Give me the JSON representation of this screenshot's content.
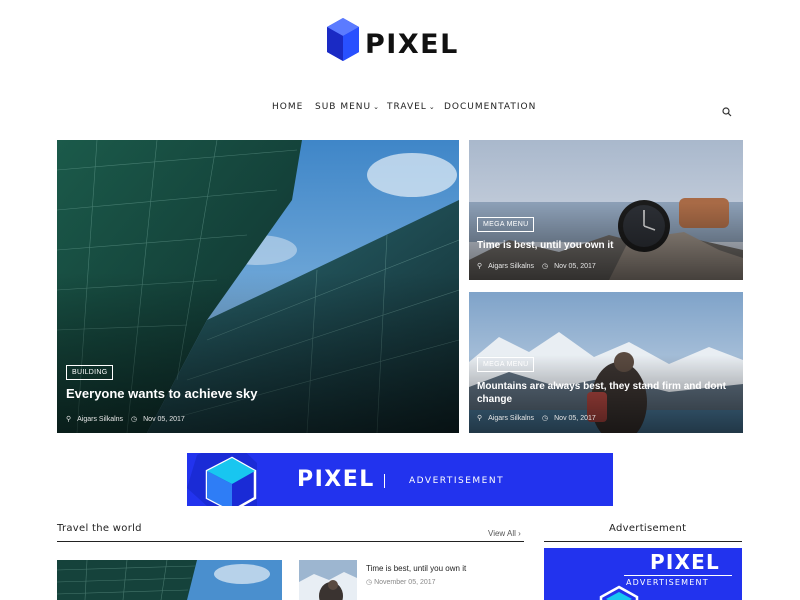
{
  "brand": {
    "name": "PIXEL",
    "accent": "#2233ee",
    "logo_icon": "hexagon-logo-icon"
  },
  "nav": {
    "items": [
      {
        "label": "HOME",
        "dropdown": false
      },
      {
        "label": "SUB MENU",
        "dropdown": true
      },
      {
        "label": "TRAVEL",
        "dropdown": true
      },
      {
        "label": "DOCUMENTATION",
        "dropdown": false
      }
    ],
    "chevron": "⌄",
    "search_icon": "search-icon"
  },
  "features": {
    "main": {
      "category": "BUILDING",
      "title": "Everyone wants to achieve sky",
      "author": "Aigars Silkalns",
      "date": "Nov 05, 2017"
    },
    "top_right": {
      "category": "MEGA MENU",
      "title": "Time is best, until you own it",
      "author": "Aigars Silkalns",
      "date": "Nov 05, 2017"
    },
    "bottom_right": {
      "category": "MEGA MENU",
      "title": "Mountains are always best, they stand firm and dont change",
      "author": "Aigars Silkalns",
      "date": "Nov 05, 2017"
    }
  },
  "ad_banner": {
    "word": "PIXEL",
    "sub": "ADVERTISEMENT"
  },
  "travel_section": {
    "title": "Travel the world",
    "view_all": "View All ›",
    "list": [
      {
        "title": "Time is best, until you own it",
        "date": "November 05, 2017"
      }
    ]
  },
  "sidebar": {
    "title": "Advertisement",
    "ad": {
      "word": "PIXEL",
      "sub": "ADVERTISEMENT"
    }
  },
  "meta_icons": {
    "author": "user-icon",
    "date": "clock-icon"
  }
}
